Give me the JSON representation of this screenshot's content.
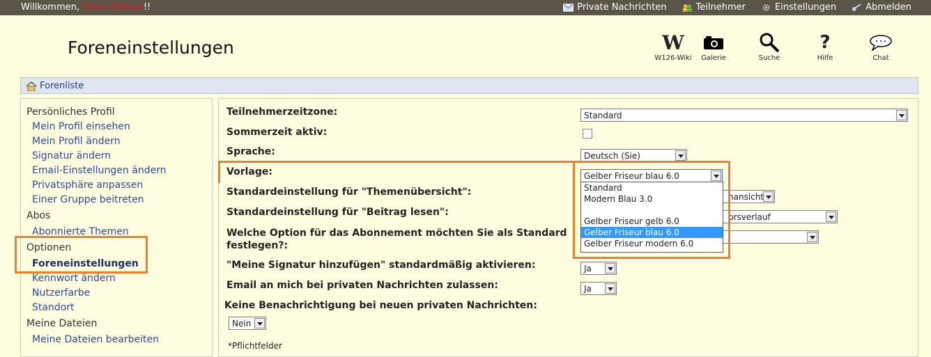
{
  "topbar": {
    "welcome_prefix": "Willkommen, ",
    "username": "Hans-Dieter",
    "welcome_suffix": "!!",
    "links": [
      "Private Nachrichten",
      "Teilnehmer",
      "Einstellungen",
      "Abmelden"
    ]
  },
  "page_title": "Foreneinstellungen",
  "iconbar": [
    {
      "label": "W126-Wiki",
      "icon": "wiki-icon"
    },
    {
      "label": "Galerie",
      "icon": "camera-icon"
    },
    {
      "label": "Suche",
      "icon": "magnifier-icon"
    },
    {
      "label": "Hilfe",
      "icon": "question-icon"
    },
    {
      "label": "Chat",
      "icon": "speech-bubble-icon"
    }
  ],
  "breadcrumb": {
    "label": "Forenliste",
    "icon": "home-icon"
  },
  "sidebar": {
    "sections": [
      {
        "title": "Persönliches Profil",
        "items": [
          "Mein Profil einsehen",
          "Mein Profil ändern",
          "Signatur ändern",
          "Email-Einstellungen ändern",
          "Privatsphäre anpassen",
          "Einer Gruppe beitreten"
        ]
      },
      {
        "title": "Abos",
        "items": [
          "Abonnierte Themen"
        ]
      },
      {
        "title": "Optionen",
        "items": [
          "Foreneinstellungen",
          "Kennwort ändern",
          "Nutzerfarbe",
          "Standort"
        ]
      },
      {
        "title": "Meine Dateien",
        "items": [
          "Meine Dateien bearbeiten"
        ]
      }
    ],
    "active_item": "Foreneinstellungen"
  },
  "form": {
    "timezone_label": "Teilnehmerzeitzone:",
    "timezone_value": "Standard",
    "dst_label": "Sommerzeit aktiv:",
    "language_label": "Sprache:",
    "language_value": "Deutsch (Sie)",
    "template_label": "Vorlage:",
    "template_value": "Gelber Friseur blau 6.0",
    "topic_default_label": "Standardeinstellung für \"Themenübersicht\":",
    "topic_default_value_partial": "nansicht",
    "read_default_label": "Standardeinstellung für \"Beitrag lesen\":",
    "read_default_value_partial": "prsverlauf",
    "subscription_label_1": "Welche Option für das Abonnement möchten Sie als Standard",
    "subscription_label_2": "festlegen?:",
    "signature_label": "\"Meine Signatur hinzufügen\" standardmäßig aktivieren:",
    "signature_value": "Ja",
    "email_pm_label": "Email an mich bei privaten Nachrichten zulassen:",
    "email_pm_value": "Ja",
    "no_notify_label": "Keine Benachrichtigung bei neuen privaten Nachrichten:",
    "no_notify_value": "Nein",
    "required_note": "*Pflichtfelder"
  },
  "template_dropdown_options": [
    "Standard",
    "Modern Blau 3.0",
    "",
    "Gelber Friseur gelb 6.0",
    "Gelber Friseur blau 6.0",
    "Gelber Friseur modern 6.0"
  ],
  "template_dropdown_selected_index": 4,
  "colors": {
    "highlight": "#f07f2c",
    "topbar": "#5b5549",
    "background": "#fffde0",
    "link": "#2b4c9a"
  }
}
